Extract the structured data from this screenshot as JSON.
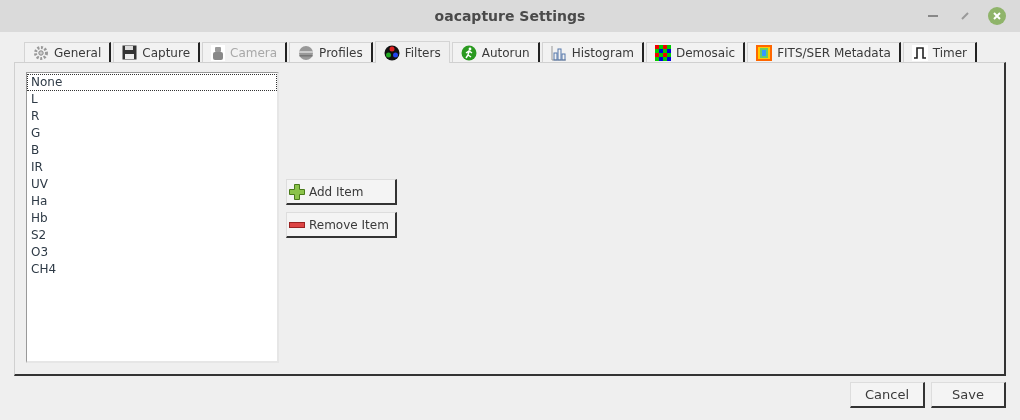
{
  "window": {
    "title": "oacapture Settings"
  },
  "tabs": [
    {
      "label": "General",
      "selected": false,
      "disabled": false
    },
    {
      "label": "Capture",
      "selected": false,
      "disabled": false
    },
    {
      "label": "Camera",
      "selected": false,
      "disabled": true
    },
    {
      "label": "Profiles",
      "selected": false,
      "disabled": false
    },
    {
      "label": "Filters",
      "selected": true,
      "disabled": false
    },
    {
      "label": "Autorun",
      "selected": false,
      "disabled": false
    },
    {
      "label": "Histogram",
      "selected": false,
      "disabled": false
    },
    {
      "label": "Demosaic",
      "selected": false,
      "disabled": false
    },
    {
      "label": "FITS/SER Metadata",
      "selected": false,
      "disabled": false
    },
    {
      "label": "Timer",
      "selected": false,
      "disabled": false
    }
  ],
  "filters": [
    {
      "label": "None",
      "selected": true
    },
    {
      "label": "L",
      "selected": false
    },
    {
      "label": "R",
      "selected": false
    },
    {
      "label": "G",
      "selected": false
    },
    {
      "label": "B",
      "selected": false
    },
    {
      "label": "IR",
      "selected": false
    },
    {
      "label": "UV",
      "selected": false
    },
    {
      "label": "Ha",
      "selected": false
    },
    {
      "label": "Hb",
      "selected": false
    },
    {
      "label": "S2",
      "selected": false
    },
    {
      "label": "O3",
      "selected": false
    },
    {
      "label": "CH4",
      "selected": false
    }
  ],
  "list_buttons": [
    {
      "label": "Add Item",
      "kind": "add"
    },
    {
      "label": "Remove Item",
      "kind": "remove"
    }
  ],
  "buttons": [
    "Cancel",
    "Save"
  ]
}
